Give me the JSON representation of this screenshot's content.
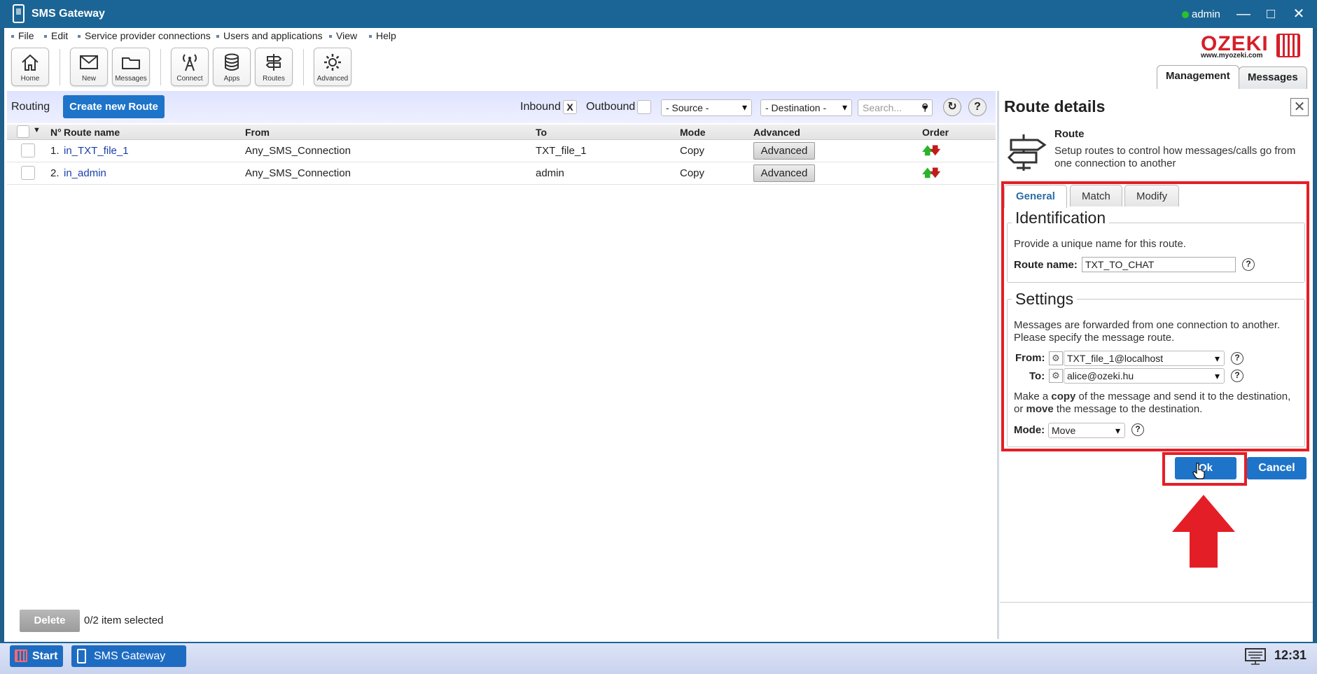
{
  "window": {
    "title": "SMS Gateway",
    "user": "admin"
  },
  "menu": [
    "File",
    "Edit",
    "Service provider connections",
    "Users and applications",
    "View",
    "Help"
  ],
  "toolbar": [
    "Home",
    "New",
    "Messages",
    "Connect",
    "Apps",
    "Routes",
    "Advanced"
  ],
  "logo": {
    "brand": "OZEKI",
    "site": "www.myozeki.com"
  },
  "right_tabs": [
    "Management",
    "Messages"
  ],
  "routing": {
    "label": "Routing",
    "create_button": "Create new Route",
    "inbound_label": "Inbound",
    "inbound_value": "X",
    "outbound_label": "Outbound",
    "source_select": "- Source -",
    "destination_select": "- Destination -",
    "search_placeholder": "Search...",
    "help": "?",
    "columns": {
      "n": "N°",
      "name": "Route name",
      "from": "From",
      "to": "To",
      "mode": "Mode",
      "advanced": "Advanced",
      "order": "Order"
    },
    "rows": [
      {
        "n": "1.",
        "name": "in_TXT_file_1",
        "from": "Any_SMS_Connection",
        "to": "TXT_file_1",
        "mode": "Copy",
        "advanced": "Advanced"
      },
      {
        "n": "2.",
        "name": "in_admin",
        "from": "Any_SMS_Connection",
        "to": "admin",
        "mode": "Copy",
        "advanced": "Advanced"
      }
    ],
    "delete_button": "Delete",
    "selection_status": "0/2 item selected"
  },
  "details": {
    "title": "Route details",
    "close": "X",
    "heading": "Route",
    "description": "Setup routes to control how messages/calls go from one connection to another",
    "tabs": [
      "General",
      "Match",
      "Modify"
    ],
    "identification": {
      "legend": "Identification",
      "hint": "Provide a unique name for this route.",
      "label": "Route name:",
      "value": "TXT_TO_CHAT"
    },
    "settings": {
      "legend": "Settings",
      "hint": "Messages are forwarded from one connection to another. Please specify the message route.",
      "from_label": "From:",
      "from_value": "TXT_file_1@localhost",
      "to_label": "To:",
      "to_value": "alice@ozeki.hu",
      "mode_hint_1": "Make a ",
      "mode_hint_copy": "copy",
      "mode_hint_2": " of the message and send it to the destination, or ",
      "mode_hint_move": "move",
      "mode_hint_3": " the message to the destination.",
      "mode_label": "Mode:",
      "mode_value": "Move"
    },
    "ok_button": "Ok",
    "cancel_button": "Cancel"
  },
  "taskbar": {
    "start": "Start",
    "task": "SMS Gateway",
    "clock": "12:31"
  }
}
